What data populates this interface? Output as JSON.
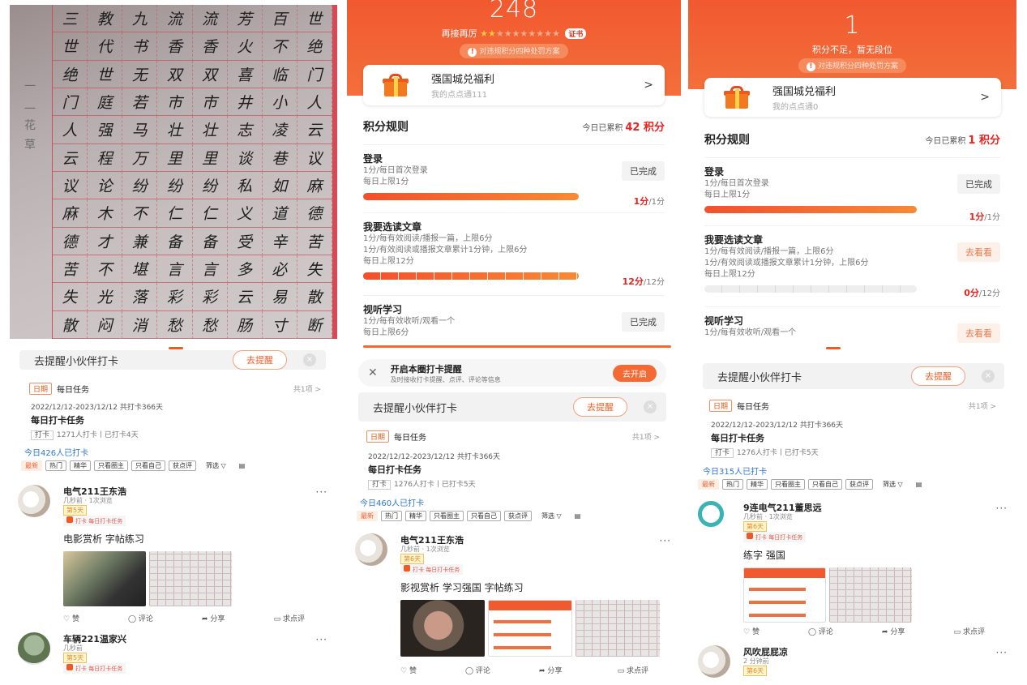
{
  "panel1": {
    "photo_rows": [
      [
        "三",
        "教",
        "九",
        "流",
        "流",
        "芳",
        "百",
        "世"
      ],
      [
        "世",
        "代",
        "书",
        "香",
        "香",
        "火",
        "不",
        "绝"
      ],
      [
        "绝",
        "世",
        "无",
        "双",
        "双",
        "喜",
        "临",
        "门"
      ],
      [
        "门",
        "庭",
        "若",
        "市",
        "市",
        "井",
        "小",
        "人"
      ],
      [
        "人",
        "强",
        "马",
        "壮",
        "壮",
        "志",
        "凌",
        "云"
      ],
      [
        "云",
        "程",
        "万",
        "里",
        "里",
        "谈",
        "巷",
        "议"
      ],
      [
        "议",
        "论",
        "纷",
        "纷",
        "纷",
        "私",
        "如",
        "麻"
      ],
      [
        "麻",
        "木",
        "不",
        "仁",
        "仁",
        "义",
        "道",
        "德"
      ],
      [
        "德",
        "才",
        "兼",
        "备",
        "备",
        "受",
        "辛",
        "苦"
      ],
      [
        "苦",
        "不",
        "堪",
        "言",
        "言",
        "多",
        "必",
        "失"
      ],
      [
        "失",
        "光",
        "落",
        "彩",
        "彩",
        "云",
        "易",
        "散"
      ],
      [
        "散",
        "闷",
        "消",
        "愁",
        "愁",
        "肠",
        "寸",
        "断"
      ]
    ],
    "photo_margin": [
      "一",
      "一",
      "花",
      "草"
    ],
    "remind_label": "去提醒小伙伴打卡",
    "remind_button": "去提醒",
    "close_glyph": "×",
    "day_tag": "日期",
    "day_task": "每日任务",
    "all_label": "共1项 >",
    "task_dates": "2022/12/12-2023/12/12 共打卡366天",
    "task_name": "每日打卡任务",
    "task_tag": "打卡",
    "task_stats": "1271人打卡丨已打卡4天",
    "today_count": "今日426人已打卡",
    "filters": [
      "最新",
      "热门",
      "精华",
      "只看圈主",
      "只看自己",
      "获点评"
    ],
    "filter_label": "筛选",
    "posts": [
      {
        "name": "电气211王东浩",
        "meta": "几秒前 · 1次浏览",
        "days": "第5天",
        "tag": "打卡",
        "task": "每日打卡任务",
        "text": "电影赏析 字帖练习"
      },
      {
        "name": "车辆221温家兴",
        "meta": "几秒前",
        "days": "第5天",
        "tag": "打卡",
        "task": "每日打卡任务",
        "text": ""
      }
    ],
    "actions": {
      "like": "赞",
      "comment": "评论",
      "share": "分享",
      "review": "求点评"
    }
  },
  "panel2": {
    "score": "248",
    "rank_label": "再接再厉",
    "stars_on": 2,
    "stars_total": 10,
    "badge": "证书",
    "warn": "对违规积分四种处罚方案",
    "welfare_title": "强国城兑福利",
    "welfare_sub": "我的点点通111",
    "rules_title": "积分规则",
    "today_label": "今日已累积",
    "today_points": "42 积分",
    "rules": [
      {
        "title": "登录",
        "desc": [
          "1分/每日首次登录",
          "每日上限1分"
        ],
        "button": "已完成",
        "earned": "1分",
        "limit": "/1分",
        "progress": 1
      },
      {
        "title": "我要选读文章",
        "desc": [
          "1分/每有效阅读/播报一篇，上限6分",
          "1分/有效阅读或播报文章累计1分钟，上限6分",
          "每日上限12分"
        ],
        "button": "已完成",
        "earned": "12分",
        "limit": "/12分",
        "progress": 1
      },
      {
        "title": "视听学习",
        "desc": [
          "1分/每有效收听/观看一个",
          "每日上限6分"
        ],
        "button": "已完成",
        "earned": "",
        "limit": "",
        "progress": 1
      }
    ],
    "open_title": "开启本圈打卡提醒",
    "open_sub": "及时接收打卡提醒、点评、评论等信息",
    "open_button": "去开启",
    "remind_label": "去提醒小伙伴打卡",
    "remind_button": "去提醒",
    "day_tag": "日期",
    "day_task": "每日任务",
    "all_label": "共1项 >",
    "task_dates": "2022/12/12-2023/12/12 共打卡366天",
    "task_name": "每日打卡任务",
    "task_tag": "打卡",
    "task_stats": "1276人打卡丨已打卡5天",
    "today_count": "今日460人已打卡",
    "filters": [
      "最新",
      "热门",
      "精华",
      "只看圈主",
      "只看自己",
      "获点评"
    ],
    "filter_label": "筛选",
    "post": {
      "name": "电气211王东浩",
      "meta": "几秒前 · 1次浏览",
      "days": "第6天",
      "tag": "打卡",
      "task": "每日打卡任务",
      "text": "影视赏析 学习强国 字帖练习"
    },
    "actions": {
      "like": "赞",
      "comment": "评论",
      "share": "分享",
      "review": "求点评"
    }
  },
  "panel3": {
    "score": "1",
    "rank_label": "积分不足，暂无段位",
    "warn": "对违规积分四种处罚方案",
    "welfare_title": "强国城兑福利",
    "welfare_sub": "我的点点通0",
    "rules_title": "积分规则",
    "today_label": "今日已累积",
    "today_points": "1 积分",
    "rules": [
      {
        "title": "登录",
        "desc": [
          "1分/每日首次登录",
          "每日上限1分"
        ],
        "button": "已完成",
        "earned": "1分",
        "limit": "/1分",
        "progress": 1
      },
      {
        "title": "我要选读文章",
        "desc": [
          "1分/每有效阅读/播报一篇，上限6分",
          "1分/有效阅读或播报文章累计1分钟，上限6分",
          "每日上限12分"
        ],
        "button": "去看看",
        "earned": "0分",
        "limit": "/12分",
        "progress": 0
      },
      {
        "title": "视听学习",
        "desc": [
          "1分/每有效收听/观看一个"
        ],
        "button": "去看看",
        "earned": "",
        "limit": "",
        "progress": 0
      }
    ],
    "remind_label": "去提醒小伙伴打卡",
    "remind_button": "去提醒",
    "day_tag": "日期",
    "day_task": "每日任务",
    "all_label": "共1项 >",
    "task_dates": "2022/12/12-2023/12/12 共打卡366天",
    "task_name": "每日打卡任务",
    "task_tag": "打卡",
    "task_stats": "1276人打卡丨已打卡5天",
    "today_count": "今日315人已打卡",
    "filters": [
      "最新",
      "热门",
      "精华",
      "只看圈主",
      "只看自己",
      "获点评"
    ],
    "filter_label": "筛选",
    "posts": [
      {
        "name": "9连电气211董思远",
        "meta": "几秒前 · 1次浏览",
        "days": "第6天",
        "tag": "打卡",
        "task": "每日打卡任务",
        "text": "练字 强国"
      },
      {
        "name": "风吹屁屁凉",
        "meta": "2 分钟前",
        "days": "第6天",
        "tag": "",
        "task": "",
        "text": ""
      }
    ],
    "actions": {
      "like": "赞",
      "comment": "评论",
      "share": "分享",
      "review": "求点评"
    }
  },
  "colors": {
    "accent": "#f05a22",
    "points_red": "#e8231f",
    "link_blue": "#2d76d6"
  }
}
